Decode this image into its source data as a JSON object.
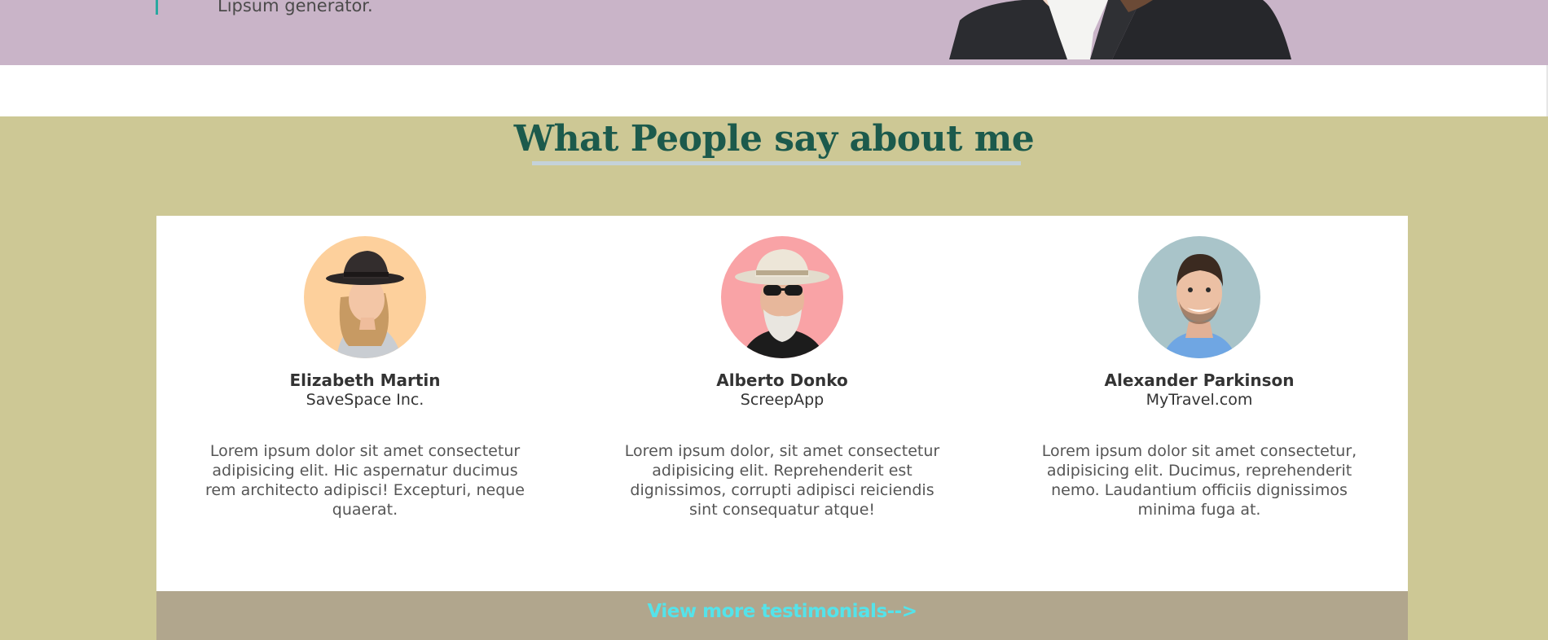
{
  "hero": {
    "text": "Lipsum generator."
  },
  "testimonials": {
    "title": "What People say about me",
    "more_link": "View more testimonials-->",
    "items": [
      {
        "name": "Elizabeth Martin",
        "company": "SaveSpace Inc.",
        "quote": "Lorem ipsum dolor sit amet consectetur adipisicing elit. Hic aspernatur ducimus rem architecto adipisci! Excepturi, neque quaerat.",
        "avatar_bg": "#fdd09c"
      },
      {
        "name": "Alberto Donko",
        "company": "ScreepApp",
        "quote": "Lorem ipsum dolor, sit amet consectetur adipisicing elit. Reprehenderit est dignissimos, corrupti adipisci reiciendis sint consequatur atque!",
        "avatar_bg": "#f9a3a6"
      },
      {
        "name": "Alexander Parkinson",
        "company": "MyTravel.com",
        "quote": "Lorem ipsum dolor sit amet consectetur, adipisicing elit. Ducimus, reprehenderit nemo. Laudantium officiis dignissimos minima fuga at.",
        "avatar_bg": "#a9c4c9"
      }
    ]
  },
  "colors": {
    "hero_bg": "#c9b4c8",
    "section_bg": "#cdc895",
    "title": "#1c5a4c",
    "more_bar": "#b1a68d",
    "more_link": "#54e3ea"
  }
}
